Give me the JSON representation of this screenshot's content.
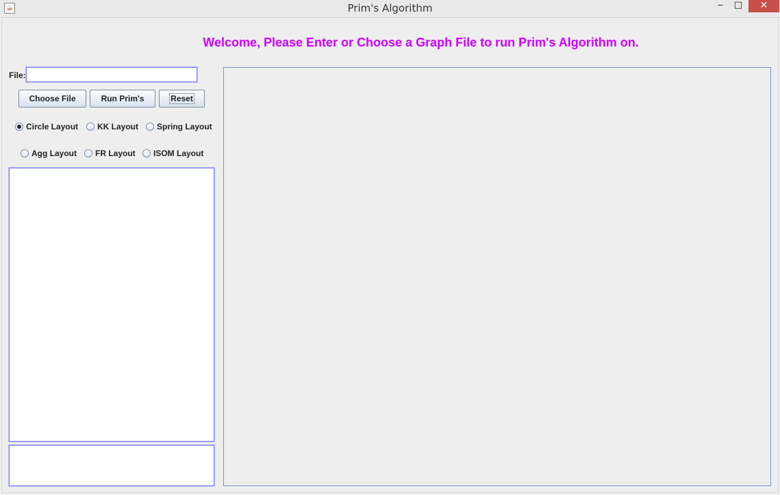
{
  "window": {
    "title": "Prim's Algorithm",
    "app_icon": "java-cup-icon",
    "controls": {
      "minimize": "‒",
      "maximize": "□",
      "close": "✕"
    }
  },
  "welcome_text": "Welcome, Please Enter or Choose a Graph File to run Prim's Algorithm on.",
  "file": {
    "label": "File:",
    "value": "",
    "placeholder": ""
  },
  "buttons": {
    "choose": "Choose File",
    "run": "Run Prim's",
    "reset": "Reset"
  },
  "layouts": [
    {
      "label": "Circle Layout",
      "selected": true
    },
    {
      "label": "KK Layout",
      "selected": false
    },
    {
      "label": "Spring Layout",
      "selected": false
    },
    {
      "label": "Agg Layout",
      "selected": false
    },
    {
      "label": "FR Layout",
      "selected": false
    },
    {
      "label": "ISOM Layout",
      "selected": false
    }
  ],
  "colors": {
    "welcome": "#cc00ff",
    "close_button": "#c7504a",
    "field_border": "#7a7aff"
  }
}
